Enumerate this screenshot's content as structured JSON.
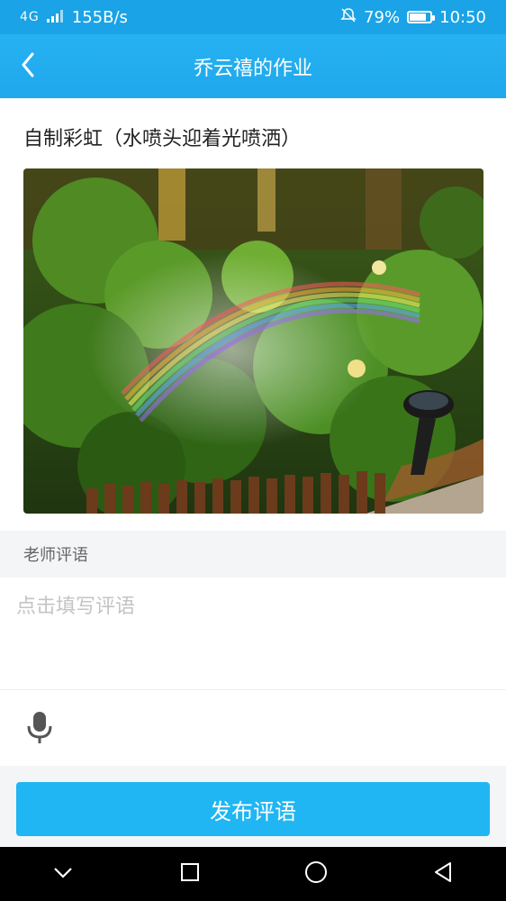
{
  "status_bar": {
    "signal_label": "4G",
    "speed": "155B/s",
    "battery": "79%",
    "battery_level": 0.79,
    "time": "10:50"
  },
  "app_bar": {
    "title": "乔云禧的作业",
    "back_icon": "chevron-left-icon"
  },
  "homework": {
    "title": "自制彩虹（水喷头迎着光喷洒）",
    "photo_subject": "garden sprinkler rainbow photo"
  },
  "comment": {
    "section_title": "老师评语",
    "placeholder": "点击填写评语",
    "value": "",
    "mic_icon": "microphone-icon"
  },
  "publish_label": "发布评语",
  "nav": {
    "buttons": [
      "chevron-down-icon",
      "square-icon",
      "circle-icon",
      "triangle-back-icon"
    ]
  },
  "colors": {
    "primary": "#1fb6f3",
    "header": "#1aa3e6",
    "section_bg": "#f4f5f7"
  }
}
